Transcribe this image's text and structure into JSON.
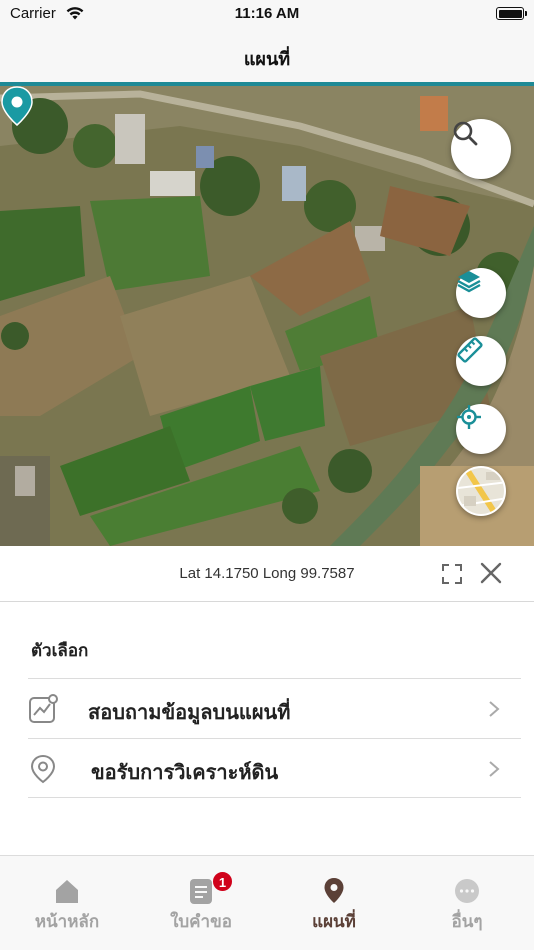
{
  "status_bar": {
    "carrier": "Carrier",
    "time": "11:16 AM"
  },
  "nav": {
    "title": "แผนที่"
  },
  "map": {
    "type": "satellite",
    "buttons": [
      {
        "name": "search",
        "icon": "search-icon"
      },
      {
        "name": "layers",
        "icon": "layers-icon"
      },
      {
        "name": "measure",
        "icon": "ruler-icon"
      },
      {
        "name": "locate",
        "icon": "crosshair-icon"
      },
      {
        "name": "basemap",
        "icon": "basemap-thumbnail-icon"
      }
    ],
    "pin_color": "#1a9aa3"
  },
  "coordinates": {
    "text": "Lat 14.1750 Long 99.7587"
  },
  "options": {
    "heading": "ตัวเลือก",
    "items": [
      {
        "label": "สอบถามข้อมูลบนแผนที่",
        "icon": "map-chart-icon"
      },
      {
        "label": "ขอรับการวิเคราะห์ดิน",
        "icon": "location-pin-icon"
      }
    ]
  },
  "tabs": [
    {
      "label": "หน้าหลัก",
      "icon": "home-icon",
      "active": false
    },
    {
      "label": "ใบคำขอ",
      "icon": "document-icon",
      "active": false,
      "badge": "1"
    },
    {
      "label": "แผนที่",
      "icon": "map-pin-icon",
      "active": true
    },
    {
      "label": "อื่นๆ",
      "icon": "more-icon",
      "active": false
    }
  ],
  "colors": {
    "accent": "#1e8a96",
    "active_tab": "#5b4037",
    "inactive_tab": "#a3a3a3",
    "badge": "#d0021b"
  }
}
